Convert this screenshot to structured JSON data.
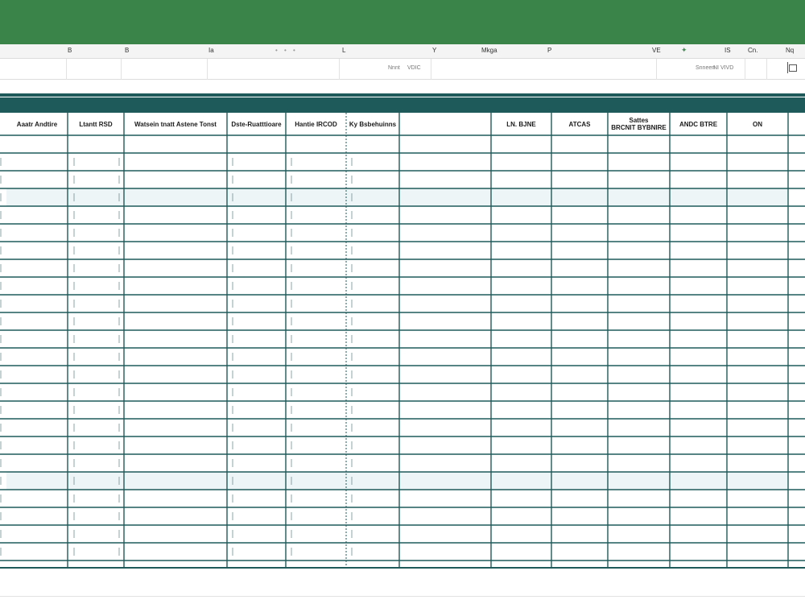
{
  "window": {
    "accent_color": "#3b8449",
    "table_line_color": "#1f5a5a"
  },
  "column_letters": [
    "B",
    "B",
    "Ia",
    "• • •",
    "L",
    "Y",
    "Mkga",
    "P",
    "VE",
    "IS",
    "Cn.",
    "Nq"
  ],
  "formula_bar": {
    "name_box_label": "Nnnt",
    "name_box_value": "VDIC",
    "status_label": "Snneen",
    "status_value": "NI VIVD"
  },
  "table": {
    "headers": [
      "Aaatr Andtire",
      "Ltantt RSD",
      "Watsein tnatt Astene Tonst",
      "Dste-Ruatttioare",
      "Hantie IRCOD",
      "Ky Bsbehuinns",
      "",
      "LN. BJNE",
      "ATCAS",
      "Sattes\nBRCNIT BYBNIRE",
      "ANDC BTRE",
      "ON",
      ""
    ]
  }
}
